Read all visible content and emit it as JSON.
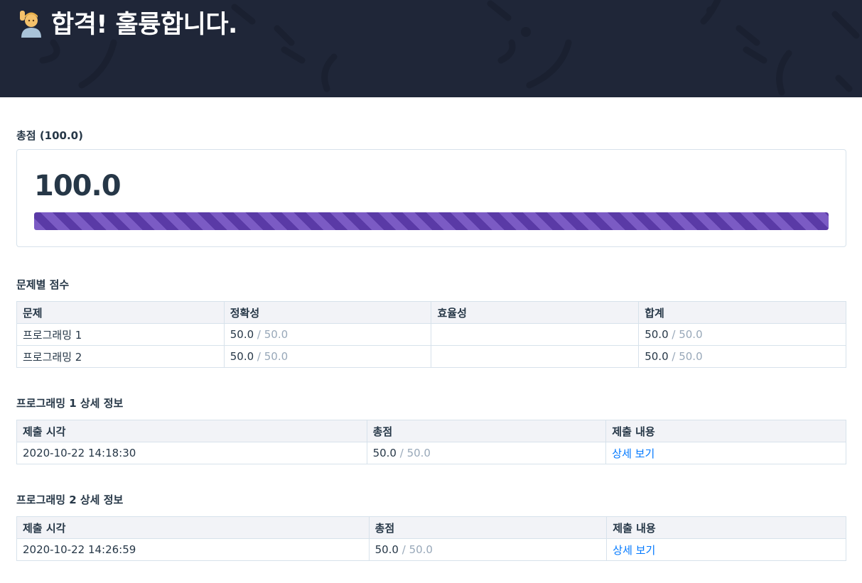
{
  "header": {
    "title": "합격! 훌륭합니다.",
    "emoji_icon": "person-raising-hand-icon"
  },
  "total": {
    "label": "총점 (100.0)",
    "value": "100.0",
    "progress_percent": 100,
    "bar_color": "#5a3aa6"
  },
  "problem_scores": {
    "title": "문제별 점수",
    "headers": [
      "문제",
      "정확성",
      "효율성",
      "합계"
    ],
    "rows": [
      {
        "name": "프로그래밍 1",
        "accuracy": "50.0",
        "accuracy_max": " / 50.0",
        "efficiency": "",
        "sum": "50.0",
        "sum_max": " / 50.0"
      },
      {
        "name": "프로그래밍 2",
        "accuracy": "50.0",
        "accuracy_max": " / 50.0",
        "efficiency": "",
        "sum": "50.0",
        "sum_max": " / 50.0"
      }
    ]
  },
  "details": [
    {
      "title": "프로그래밍 1 상세 정보",
      "headers": [
        "제출 시각",
        "총점",
        "제출 내용"
      ],
      "row": {
        "time": "2020-10-22 14:18:30",
        "score": "50.0",
        "score_max": " / 50.0",
        "link": "상세 보기"
      }
    },
    {
      "title": "프로그래밍 2 상세 정보",
      "headers": [
        "제출 시각",
        "총점",
        "제출 내용"
      ],
      "row": {
        "time": "2020-10-22 14:26:59",
        "score": "50.0",
        "score_max": " / 50.0",
        "link": "상세 보기"
      }
    }
  ]
}
